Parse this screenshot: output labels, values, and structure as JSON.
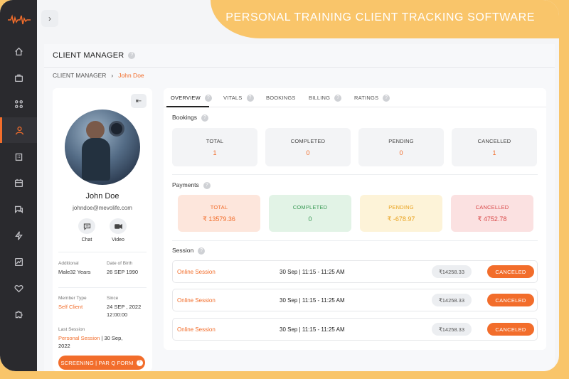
{
  "banner": {
    "headline": "PERSONAL TRAINING CLIENT TRACKING SOFTWARE"
  },
  "colors": {
    "accent": "#f26d2b",
    "sidebar": "#2a2a2e",
    "frame": "#f9c56a"
  },
  "sidebar": {
    "icons": [
      "home-icon",
      "briefcase-icon",
      "apps-icon",
      "user-icon",
      "building-icon",
      "calendar-icon",
      "chat-icon",
      "bolt-icon",
      "report-icon",
      "heart-icon",
      "puzzle-icon"
    ],
    "active": "user-icon"
  },
  "header": {
    "title": "CLIENT MANAGER",
    "help": "?"
  },
  "breadcrumb": {
    "root": "CLIENT MANAGER",
    "sep": "›",
    "current": "John Doe"
  },
  "profile": {
    "name": "John Doe",
    "email": "johndoe@mevolife.com",
    "chat_label": "Chat",
    "video_label": "Video",
    "additional_label": "Additional",
    "additional_value": "Male32 Years",
    "dob_label": "Date of Birth",
    "dob_value": "26 SEP 1990",
    "member_type_label": "Member Type",
    "member_type_value": "Self Client",
    "since_label": "Since",
    "since_value_1": "24 SEP , 2022",
    "since_value_2": "12:00:00",
    "last_session_label": "Last Session",
    "last_session_type": "Personal Session",
    "last_session_date_1": " | 30 Sep,",
    "last_session_date_2": "2022",
    "screening_label": "SCREENING | PAR Q FORM"
  },
  "tabs": [
    {
      "label": "OVERVIEW",
      "help": true
    },
    {
      "label": "VITALS",
      "help": true
    },
    {
      "label": "BOOKINGS",
      "help": false
    },
    {
      "label": "BILLING",
      "help": true
    },
    {
      "label": "RATINGS",
      "help": true
    }
  ],
  "bookings": {
    "title": "Bookings",
    "cards": [
      {
        "label": "TOTAL",
        "value": "1"
      },
      {
        "label": "COMPLETED",
        "value": "0"
      },
      {
        "label": "PENDING",
        "value": "0"
      },
      {
        "label": "CANCELLED",
        "value": "1"
      }
    ]
  },
  "payments": {
    "title": "Payments",
    "cards": [
      {
        "label": "TOTAL",
        "value": "₹ 13579.36",
        "bg": "#fde6dc",
        "color": "#f26d2b"
      },
      {
        "label": "COMPLETED",
        "value": "0",
        "bg": "#e2f3e6",
        "color": "#3a9a55"
      },
      {
        "label": "PENDING",
        "value": "₹ -678.97",
        "bg": "#fdf3d8",
        "color": "#e9a21d"
      },
      {
        "label": "CANCELLED",
        "value": "₹ 4752.78",
        "bg": "#fbe1e1",
        "color": "#d94848"
      }
    ]
  },
  "session": {
    "title": "Session",
    "rows": [
      {
        "type": "Online Session",
        "time": "30 Sep | 11:15 - 11:25 AM",
        "amount": "₹14258.33",
        "status": "CANCELED"
      },
      {
        "type": "Online Session",
        "time": "30 Sep | 11:15 - 11:25 AM",
        "amount": "₹14258.33",
        "status": "CANCELED"
      },
      {
        "type": "Online Session",
        "time": "30 Sep | 11:15 - 11:25 AM",
        "amount": "₹14258.33",
        "status": "CANCELED"
      }
    ]
  }
}
